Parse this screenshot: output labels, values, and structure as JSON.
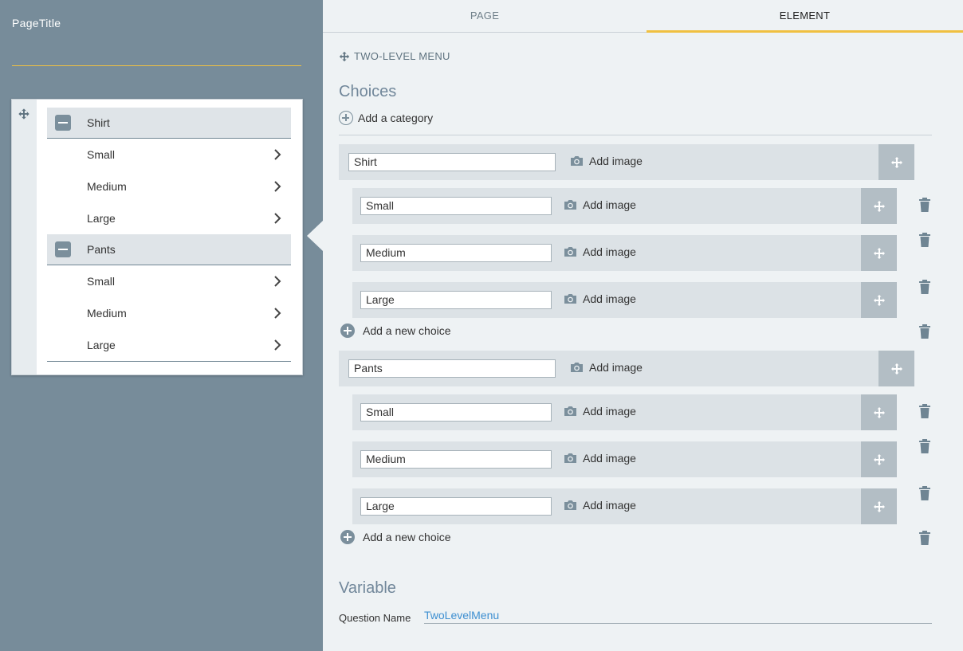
{
  "left_panel": {
    "page_title_label": "PageTitle",
    "preview": {
      "categories": [
        {
          "label": "Shirt",
          "choices": [
            "Small",
            "Medium",
            "Large"
          ]
        },
        {
          "label": "Pants",
          "choices": [
            "Small",
            "Medium",
            "Large"
          ]
        }
      ]
    }
  },
  "tabs": {
    "page": "PAGE",
    "element": "ELEMENT",
    "active": "ELEMENT"
  },
  "element_type": "TWO-LEVEL MENU",
  "choices_section": {
    "title": "Choices",
    "add_category_label": "Add a category",
    "add_image_label": "Add image",
    "add_choice_label": "Add a new choice",
    "categories": [
      {
        "value": "Shirt",
        "choices": [
          "Small",
          "Medium",
          "Large"
        ]
      },
      {
        "value": "Pants",
        "choices": [
          "Small",
          "Medium",
          "Large"
        ]
      }
    ]
  },
  "variable_section": {
    "title": "Variable",
    "question_name_label": "Question Name",
    "question_name_value": "TwoLevelMenu"
  },
  "colors": {
    "accent": "#f0c040",
    "sidebar_bg": "#778c9a",
    "panel_bg": "#eef2f4",
    "link": "#3d8fd1"
  }
}
